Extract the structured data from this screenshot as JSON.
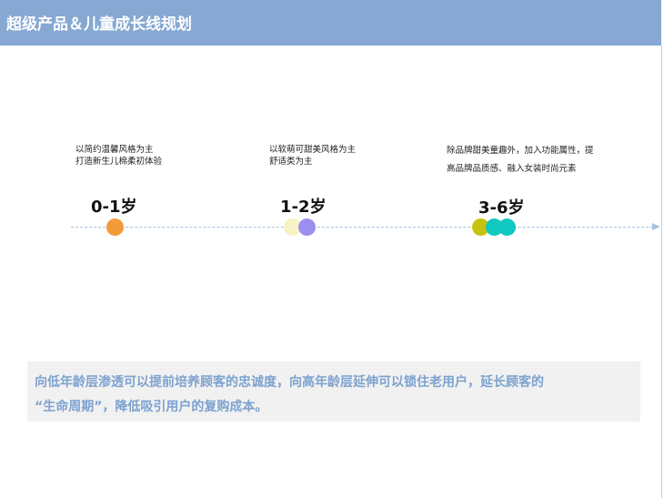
{
  "header": {
    "title": "超级产品＆儿童成长线规划"
  },
  "stages": [
    {
      "age": "0-1岁",
      "lines": [
        "以简约温馨风格为主",
        "打造新生儿棉柔初体验"
      ]
    },
    {
      "age": "1-2岁",
      "lines": [
        "以软萌可甜美风格为主",
        "舒适类为主"
      ]
    },
    {
      "age": "3-6岁",
      "lines": [
        "除品牌甜美童趣外，加入功能属性，提",
        "高品牌品质感、融入女装时尚元素"
      ]
    }
  ],
  "colors": {
    "header_bg": "#86a8d3",
    "dot_orange": "#f39a3a",
    "dot_cream": "#f7f2c4",
    "dot_purple": "#9b8ff0",
    "dot_olive": "#c6c212",
    "dot_teal": "#11c8c0",
    "note_text": "#7da2cf"
  },
  "note": {
    "line1": "向低年龄层渗透可以提前培养顾客的忠诚度，向高年龄层延伸可以锁住老用户，延长顾客的",
    "line2": "“生命周期”，降低吸引用户的复购成本。"
  }
}
